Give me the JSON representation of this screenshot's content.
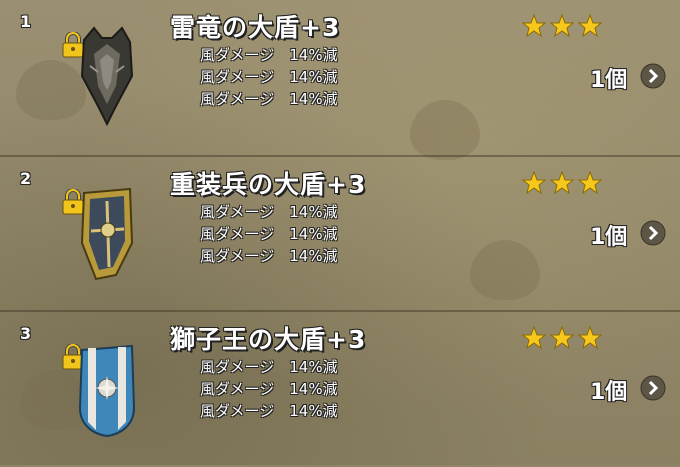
{
  "items": [
    {
      "index": "1",
      "name": "雷竜の大盾+3",
      "effects": [
        "風ダメージ　14%減",
        "風ダメージ　14%減",
        "風ダメージ　14%減"
      ],
      "stars": 3,
      "count": "1個",
      "shield_icon": "thunder-dragon-shield-icon",
      "locked": true
    },
    {
      "index": "2",
      "name": "重装兵の大盾+3",
      "effects": [
        "風ダメージ　14%減",
        "風ダメージ　14%減",
        "風ダメージ　14%減"
      ],
      "stars": 3,
      "count": "1個",
      "shield_icon": "heavy-soldier-shield-icon",
      "locked": true
    },
    {
      "index": "3",
      "name": "獅子王の大盾+3",
      "effects": [
        "風ダメージ　14%減",
        "風ダメージ　14%減",
        "風ダメージ　14%減"
      ],
      "stars": 3,
      "count": "1個",
      "shield_icon": "lion-king-shield-icon",
      "locked": true
    }
  ],
  "colors": {
    "star": "#f6c81b",
    "text": "#ffffff",
    "background": "#8f8566",
    "lock": "#f2c51a"
  }
}
